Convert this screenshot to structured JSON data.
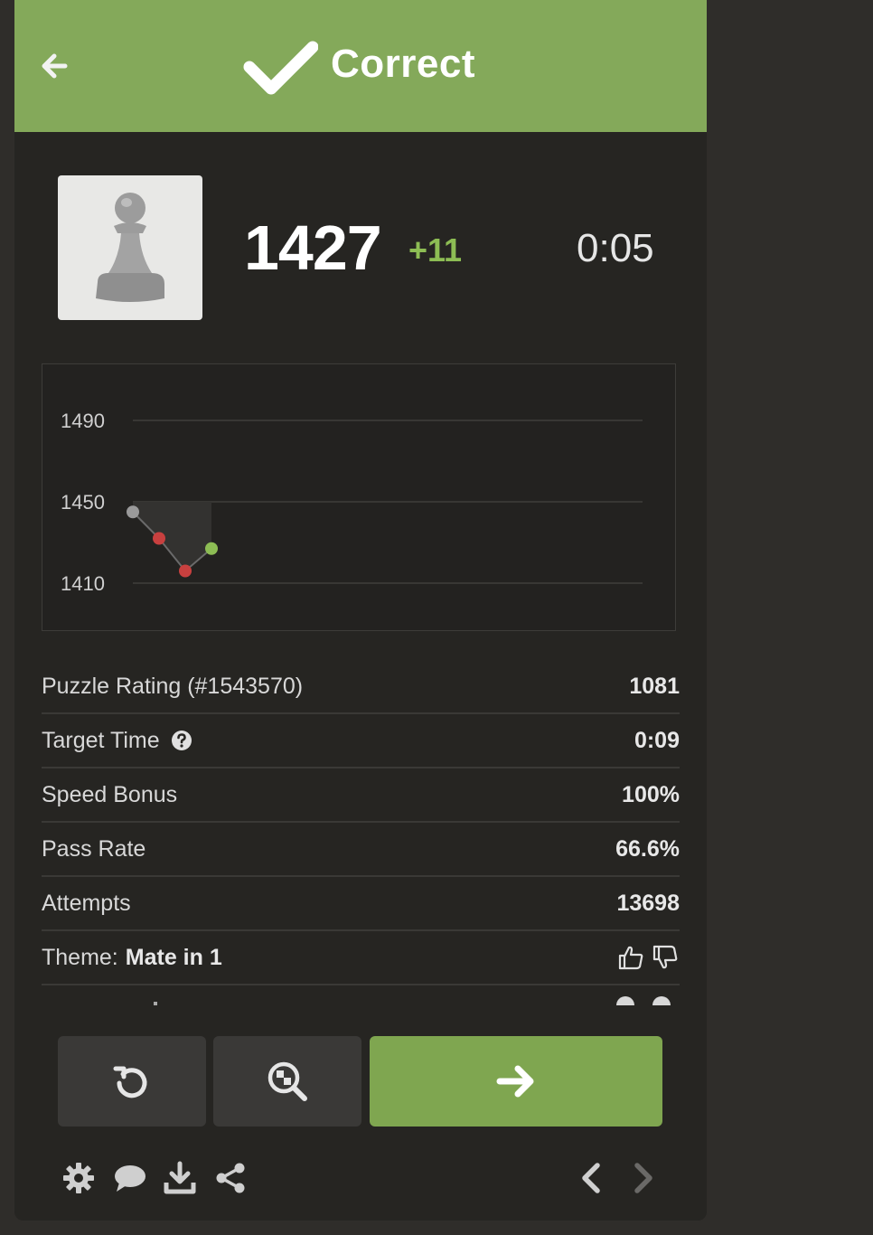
{
  "header": {
    "title": "Correct",
    "back_icon": "arrow-left-icon",
    "check_icon": "checkmark-icon",
    "background": "#84a95a"
  },
  "player": {
    "avatar_icon": "pawn-icon",
    "rating": "1427",
    "rating_delta": "+11",
    "timer": "0:05"
  },
  "chart_data": {
    "type": "line",
    "y_ticks": [
      "1490",
      "1450",
      "1410"
    ],
    "ylim": [
      1410,
      1490
    ],
    "points": [
      {
        "index": 0,
        "value": 1445,
        "color": "#9a9a9a"
      },
      {
        "index": 1,
        "value": 1432,
        "color": "#c8403f"
      },
      {
        "index": 2,
        "value": 1416,
        "color": "#c8403f"
      },
      {
        "index": 3,
        "value": 1427,
        "color": "#8dbd54"
      }
    ],
    "grid": true
  },
  "stats": [
    {
      "label": "Puzzle Rating (#1543570)",
      "value": "1081"
    },
    {
      "label": "Target Time",
      "value": "0:09"
    },
    {
      "label": "Speed Bonus",
      "value": "100%"
    },
    {
      "label": "Pass Rate",
      "value": "66.6%"
    },
    {
      "label": "Attempts",
      "value": "13698"
    }
  ],
  "theme": {
    "label": "Theme:",
    "value": "Mate in 1"
  },
  "buttons": {
    "retry_icon": "retry-icon",
    "analysis_icon": "analysis-icon",
    "next_icon": "arrow-right-icon"
  },
  "toolbar": {
    "icons": [
      "gear-icon",
      "chat-icon",
      "download-icon",
      "share-icon"
    ],
    "nav_icons": [
      "chevron-left-icon",
      "chevron-right-icon"
    ]
  }
}
